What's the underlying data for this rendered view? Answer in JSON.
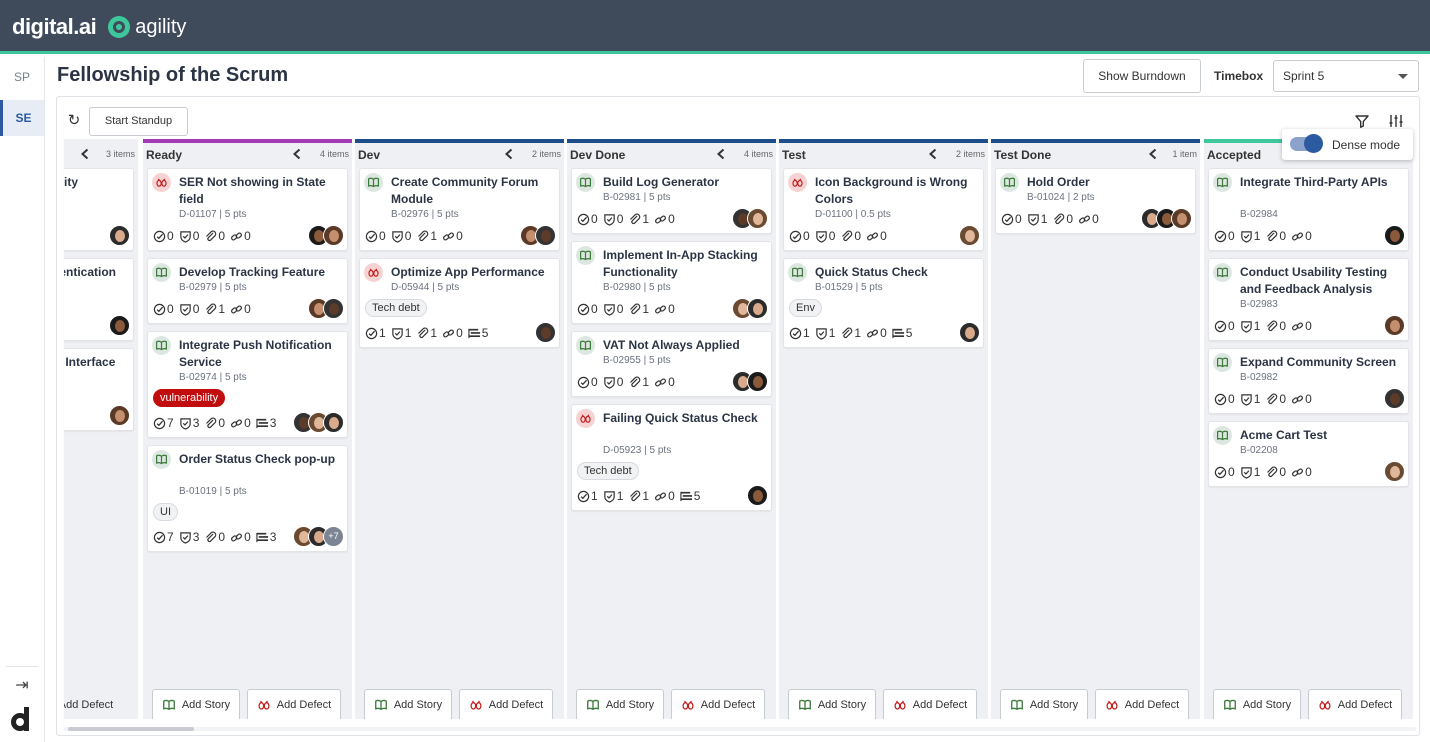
{
  "brand": {
    "company": "digital.ai",
    "product": "agility"
  },
  "rail": {
    "items": [
      "SP",
      "SE"
    ],
    "active": "SE"
  },
  "page": {
    "title": "Fellowship of the Scrum",
    "burndown_label": "Show Burndown",
    "timebox_label": "Timebox",
    "timebox_value": "Sprint 5",
    "standup_label": "Start Standup",
    "dense_label": "Dense mode",
    "dense_on": true
  },
  "colors": {
    "header_bg": "#3f4b5b",
    "accent": "#3ec79b",
    "active_blue": "#2c5aa0",
    "ready_bar": "#a339b6",
    "status_bar": "#1d4e8a",
    "accepted_bar": "#3ec79b",
    "vulnerability_tag": "#c10d0d"
  },
  "columns": [
    {
      "title": "",
      "count": "3 items",
      "bar": "#1d4e8a",
      "partial": true,
      "cards": [
        {
          "type": "story",
          "title": "urity",
          "meta": "",
          "tags": [],
          "stats": [
            "",
            "",
            "",
            ""
          ],
          "avatars": 1
        },
        {
          "type": "story",
          "title": "hentication",
          "meta": "",
          "tags": [],
          "stats": [
            "",
            "",
            "",
            ""
          ],
          "avatars": 1
        },
        {
          "type": "story",
          "title": "le Interface",
          "meta": "",
          "tags": [],
          "stats": [
            "",
            "",
            "",
            ""
          ],
          "avatars": 1
        }
      ],
      "add_story": "",
      "add_defect": "Add Defect"
    },
    {
      "title": "Ready",
      "count": "4 items",
      "bar": "#a339b6",
      "cards": [
        {
          "type": "defect",
          "title": "SER Not showing in State field",
          "meta": "D-01107 | 5 pts",
          "tags": [],
          "stats": [
            "0",
            "0",
            "0",
            "0"
          ],
          "avatars": 2
        },
        {
          "type": "story",
          "title": "Develop Tracking Feature",
          "meta": "B-02979 | 5 pts",
          "tags": [],
          "stats": [
            "0",
            "0",
            "1",
            "0"
          ],
          "avatars": 2
        },
        {
          "type": "story",
          "title": "Integrate Push Notification Service",
          "meta": "B-02974 | 5 pts",
          "tags": [
            {
              "label": "vulnerability",
              "red": true
            }
          ],
          "stats": [
            "7",
            "3",
            "0",
            "0",
            "3"
          ],
          "avatars": 3
        },
        {
          "type": "story",
          "title": "Order Status Check pop-up",
          "meta": "B-01019 | 5 pts",
          "tags": [
            {
              "label": "UI",
              "red": false
            }
          ],
          "stats": [
            "7",
            "3",
            "0",
            "0",
            "3"
          ],
          "avatars": 2,
          "more": "+7"
        }
      ],
      "add_story": "Add Story",
      "add_defect": "Add Defect"
    },
    {
      "title": "Dev",
      "count": "2 items",
      "bar": "#1d4e8a",
      "cards": [
        {
          "type": "story",
          "title": "Create Community Forum Module",
          "meta": "B-02976 | 5 pts",
          "tags": [],
          "stats": [
            "0",
            "0",
            "1",
            "0"
          ],
          "avatars": 2
        },
        {
          "type": "defect",
          "title": "Optimize App Performance",
          "meta": "D-05944 | 5 pts",
          "tags": [
            {
              "label": "Tech debt",
              "red": false
            }
          ],
          "stats": [
            "1",
            "1",
            "1",
            "0",
            "5"
          ],
          "avatars": 1
        }
      ],
      "add_story": "Add Story",
      "add_defect": "Add Defect"
    },
    {
      "title": "Dev Done",
      "count": "4 items",
      "bar": "#1d4e8a",
      "cards": [
        {
          "type": "story",
          "title": "Build Log Generator",
          "meta": "B-02981 | 5 pts",
          "tags": [],
          "stats": [
            "0",
            "0",
            "1",
            "0"
          ],
          "avatars": 2
        },
        {
          "type": "story",
          "title": "Implement In-App Stacking Functionality",
          "meta": "B-02980 | 5 pts",
          "tags": [],
          "stats": [
            "0",
            "0",
            "1",
            "0"
          ],
          "avatars": 2
        },
        {
          "type": "story",
          "title": "VAT Not Always Applied",
          "meta": "B-02955 | 5 pts",
          "tags": [],
          "stats": [
            "0",
            "0",
            "1",
            "0"
          ],
          "avatars": 2
        },
        {
          "type": "defect",
          "title": "Failing Quick Status Check",
          "meta": "D-05923 | 5 pts",
          "tags": [
            {
              "label": "Tech debt",
              "red": false
            }
          ],
          "stats": [
            "1",
            "1",
            "1",
            "0",
            "5"
          ],
          "avatars": 1
        }
      ],
      "add_story": "Add Story",
      "add_defect": "Add Defect"
    },
    {
      "title": "Test",
      "count": "2 items",
      "bar": "#1d4e8a",
      "cards": [
        {
          "type": "defect",
          "title": "Icon Background is Wrong Colors",
          "meta": "D-01100 | 0.5 pts",
          "tags": [],
          "stats": [
            "0",
            "0",
            "0",
            "0"
          ],
          "avatars": 1
        },
        {
          "type": "story",
          "title": "Quick Status Check",
          "meta": "B-01529 | 5 pts",
          "tags": [
            {
              "label": "Env",
              "red": false
            }
          ],
          "stats": [
            "1",
            "1",
            "1",
            "0",
            "5"
          ],
          "avatars": 1
        }
      ],
      "add_story": "Add Story",
      "add_defect": "Add Defect"
    },
    {
      "title": "Test Done",
      "count": "1 item",
      "bar": "#1d4e8a",
      "cards": [
        {
          "type": "story",
          "title": "Hold Order",
          "meta": "B-01024 | 2 pts",
          "tags": [],
          "stats": [
            "0",
            "1",
            "0",
            "0"
          ],
          "avatars": 3
        }
      ],
      "add_story": "Add Story",
      "add_defect": "Add Defect"
    },
    {
      "title": "Accepted",
      "count": "",
      "bar": "#3ec79b",
      "cards": [
        {
          "type": "story",
          "title": "Integrate Third-Party APIs",
          "meta": "B-02984",
          "tags": [],
          "stats": [
            "0",
            "1",
            "0",
            "0"
          ],
          "avatars": 1
        },
        {
          "type": "story",
          "title": "Conduct Usability Testing and Feedback Analysis",
          "meta": "B-02983",
          "tags": [],
          "stats": [
            "0",
            "1",
            "0",
            "0"
          ],
          "avatars": 1
        },
        {
          "type": "story",
          "title": "Expand Community Screen",
          "meta": "B-02982",
          "tags": [],
          "stats": [
            "0",
            "1",
            "0",
            "0"
          ],
          "avatars": 1
        },
        {
          "type": "story",
          "title": "Acme Cart Test",
          "meta": "B-02208",
          "tags": [],
          "stats": [
            "0",
            "1",
            "0",
            "0"
          ],
          "avatars": 1
        }
      ],
      "add_story": "Add Story",
      "add_defect": "Add Defect"
    }
  ]
}
